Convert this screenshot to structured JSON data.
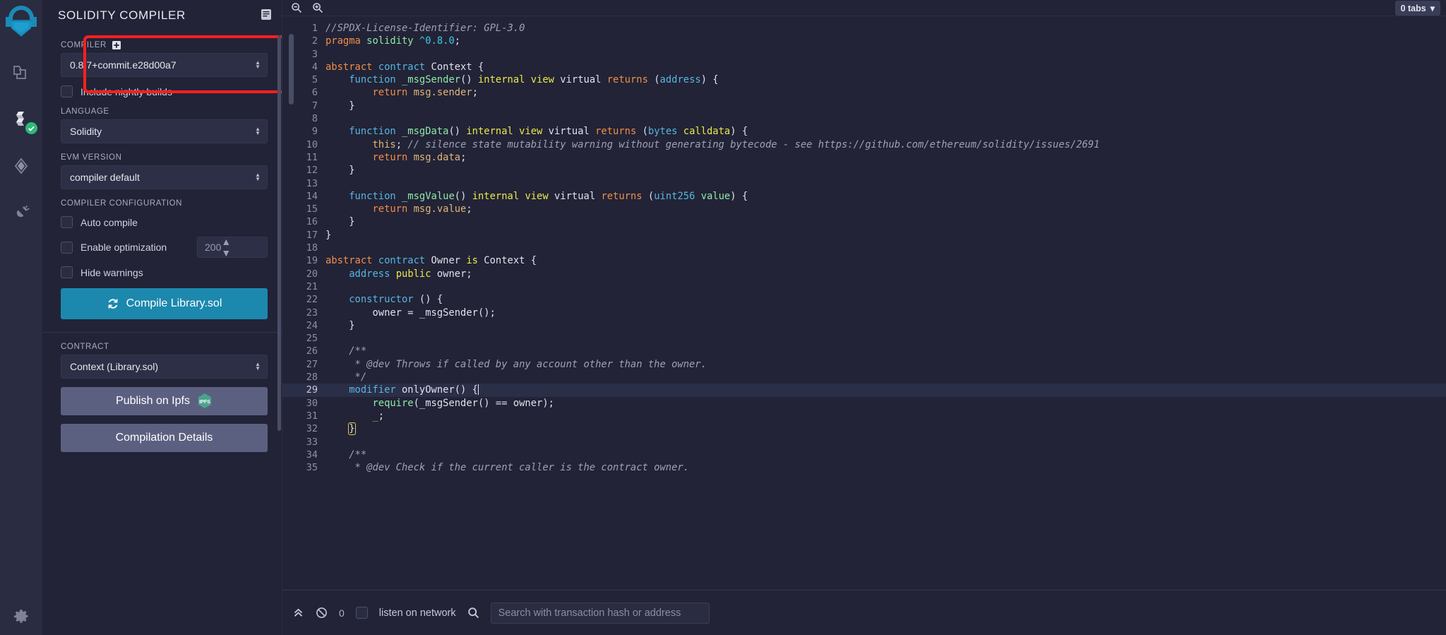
{
  "rail": {
    "logo_icon": "remix-logo-icon",
    "items": [
      {
        "name": "file-explorer-icon",
        "title": "File explorers"
      },
      {
        "name": "solidity-compiler-icon",
        "title": "Solidity compiler",
        "badge": "check"
      },
      {
        "name": "deploy-run-icon",
        "title": "Deploy & run transactions"
      },
      {
        "name": "plugin-manager-icon",
        "title": "Plugin manager"
      }
    ],
    "settings": {
      "name": "settings-gear-icon",
      "title": "Settings"
    }
  },
  "panel": {
    "title": "SOLIDITY COMPILER",
    "header_icon": "article-icon",
    "compiler_label": "COMPILER",
    "compiler_help_icon": "plus-square-icon",
    "compiler_value": "0.8.7+commit.e28d00a7",
    "nightly_label": "Include nightly builds",
    "nightly_checked": false,
    "language_label": "LANGUAGE",
    "language_value": "Solidity",
    "evm_label": "EVM VERSION",
    "evm_value": "compiler default",
    "config_label": "COMPILER CONFIGURATION",
    "auto_compile_label": "Auto compile",
    "auto_compile_checked": false,
    "optimization_label": "Enable optimization",
    "optimization_checked": false,
    "runs_value": "200",
    "hide_warnings_label": "Hide warnings",
    "hide_warnings_checked": false,
    "compile_button": "Compile Library.sol",
    "compile_icon": "refresh-icon",
    "contract_label": "CONTRACT",
    "contract_value": "Context (Library.sol)",
    "publish_button": "Publish on Ipfs",
    "publish_icon": "ipfs-icon",
    "details_button": "Compilation Details"
  },
  "editor": {
    "zoom_out_icon": "zoom-out-icon",
    "zoom_in_icon": "zoom-in-icon",
    "tabs_badge": "0 tabs",
    "tabs_caret_icon": "caret-down-icon",
    "current_line": 29,
    "lines": [
      {
        "n": 1,
        "fold": false,
        "tokens": [
          [
            "cm",
            "//SPDX-License-Identifier: GPL-3.0"
          ]
        ]
      },
      {
        "n": 2,
        "fold": false,
        "tokens": [
          [
            "kw",
            "pragma"
          ],
          [
            "pl",
            " "
          ],
          [
            "id",
            "solidity"
          ],
          [
            "pl",
            " "
          ],
          [
            "num",
            "^0.8.0"
          ],
          [
            "pl",
            ";"
          ]
        ]
      },
      {
        "n": 3,
        "fold": false,
        "tokens": []
      },
      {
        "n": 4,
        "fold": true,
        "tokens": [
          [
            "kw",
            "abstract"
          ],
          [
            "pl",
            " "
          ],
          [
            "ty",
            "contract"
          ],
          [
            "pl",
            " Context {"
          ]
        ]
      },
      {
        "n": 5,
        "fold": true,
        "tokens": [
          [
            "pl",
            "    "
          ],
          [
            "ty",
            "function"
          ],
          [
            "pl",
            " "
          ],
          [
            "id",
            "_msgSender"
          ],
          [
            "pl",
            "() "
          ],
          [
            "mod",
            "internal view"
          ],
          [
            "pl",
            " virtual "
          ],
          [
            "kw",
            "returns"
          ],
          [
            "pl",
            " ("
          ],
          [
            "ty",
            "address"
          ],
          [
            "pl",
            ") {"
          ]
        ]
      },
      {
        "n": 6,
        "fold": false,
        "tokens": [
          [
            "pl",
            "        "
          ],
          [
            "kw",
            "return"
          ],
          [
            "pl",
            " "
          ],
          [
            "str",
            "msg.sender"
          ],
          [
            "pl",
            ";"
          ]
        ]
      },
      {
        "n": 7,
        "fold": false,
        "tokens": [
          [
            "pl",
            "    }"
          ]
        ]
      },
      {
        "n": 8,
        "fold": false,
        "tokens": []
      },
      {
        "n": 9,
        "fold": true,
        "tokens": [
          [
            "pl",
            "    "
          ],
          [
            "ty",
            "function"
          ],
          [
            "pl",
            " "
          ],
          [
            "id",
            "_msgData"
          ],
          [
            "pl",
            "() "
          ],
          [
            "mod",
            "internal view"
          ],
          [
            "pl",
            " virtual "
          ],
          [
            "kw",
            "returns"
          ],
          [
            "pl",
            " ("
          ],
          [
            "ty",
            "bytes"
          ],
          [
            "pl",
            " "
          ],
          [
            "mod",
            "calldata"
          ],
          [
            "pl",
            ") {"
          ]
        ]
      },
      {
        "n": 10,
        "fold": false,
        "tokens": [
          [
            "pl",
            "        "
          ],
          [
            "str",
            "this"
          ],
          [
            "pl",
            "; "
          ],
          [
            "cm",
            "// silence state mutability warning without generating bytecode - see https://github.com/ethereum/solidity/issues/2691"
          ]
        ]
      },
      {
        "n": 11,
        "fold": false,
        "tokens": [
          [
            "pl",
            "        "
          ],
          [
            "kw",
            "return"
          ],
          [
            "pl",
            " "
          ],
          [
            "str",
            "msg.data"
          ],
          [
            "pl",
            ";"
          ]
        ]
      },
      {
        "n": 12,
        "fold": false,
        "tokens": [
          [
            "pl",
            "    }"
          ]
        ]
      },
      {
        "n": 13,
        "fold": false,
        "tokens": []
      },
      {
        "n": 14,
        "fold": true,
        "tokens": [
          [
            "pl",
            "    "
          ],
          [
            "ty",
            "function"
          ],
          [
            "pl",
            " "
          ],
          [
            "id",
            "_msgValue"
          ],
          [
            "pl",
            "() "
          ],
          [
            "mod",
            "internal view"
          ],
          [
            "pl",
            " virtual "
          ],
          [
            "kw",
            "returns"
          ],
          [
            "pl",
            " ("
          ],
          [
            "ty",
            "uint256"
          ],
          [
            "pl",
            " "
          ],
          [
            "id",
            "value"
          ],
          [
            "pl",
            ") {"
          ]
        ]
      },
      {
        "n": 15,
        "fold": false,
        "tokens": [
          [
            "pl",
            "        "
          ],
          [
            "kw",
            "return"
          ],
          [
            "pl",
            " "
          ],
          [
            "str",
            "msg.value"
          ],
          [
            "pl",
            ";"
          ]
        ]
      },
      {
        "n": 16,
        "fold": false,
        "tokens": [
          [
            "pl",
            "    }"
          ]
        ]
      },
      {
        "n": 17,
        "fold": false,
        "tokens": [
          [
            "pl",
            "}"
          ]
        ]
      },
      {
        "n": 18,
        "fold": false,
        "tokens": []
      },
      {
        "n": 19,
        "fold": true,
        "tokens": [
          [
            "kw",
            "abstract"
          ],
          [
            "pl",
            " "
          ],
          [
            "ty",
            "contract"
          ],
          [
            "pl",
            " Owner "
          ],
          [
            "mod",
            "is"
          ],
          [
            "pl",
            " Context {"
          ]
        ]
      },
      {
        "n": 20,
        "fold": false,
        "tokens": [
          [
            "pl",
            "    "
          ],
          [
            "ty",
            "address"
          ],
          [
            "pl",
            " "
          ],
          [
            "mod",
            "public"
          ],
          [
            "pl",
            " owner;"
          ]
        ]
      },
      {
        "n": 21,
        "fold": false,
        "tokens": []
      },
      {
        "n": 22,
        "fold": true,
        "tokens": [
          [
            "pl",
            "    "
          ],
          [
            "ty",
            "constructor"
          ],
          [
            "pl",
            " () {"
          ]
        ]
      },
      {
        "n": 23,
        "fold": false,
        "tokens": [
          [
            "pl",
            "        owner = _msgSender();"
          ]
        ]
      },
      {
        "n": 24,
        "fold": false,
        "tokens": [
          [
            "pl",
            "    }"
          ]
        ]
      },
      {
        "n": 25,
        "fold": false,
        "tokens": []
      },
      {
        "n": 26,
        "fold": true,
        "tokens": [
          [
            "cm",
            "    /**"
          ]
        ]
      },
      {
        "n": 27,
        "fold": false,
        "tokens": [
          [
            "cm",
            "     * @dev Throws if called by any account other than the owner."
          ]
        ]
      },
      {
        "n": 28,
        "fold": false,
        "tokens": [
          [
            "cm",
            "     */"
          ]
        ]
      },
      {
        "n": 29,
        "fold": true,
        "tokens": [
          [
            "pl",
            "    "
          ],
          [
            "ty",
            "modifier"
          ],
          [
            "pl",
            " onlyOwner() {"
          ]
        ]
      },
      {
        "n": 30,
        "fold": false,
        "tokens": [
          [
            "pl",
            "        "
          ],
          [
            "id",
            "require"
          ],
          [
            "pl",
            "(_msgSender() == owner);"
          ]
        ]
      },
      {
        "n": 31,
        "fold": false,
        "tokens": [
          [
            "pl",
            "        "
          ],
          [
            "kw",
            "_"
          ],
          [
            "pl",
            ";"
          ]
        ]
      },
      {
        "n": 32,
        "fold": false,
        "tokens": [
          [
            "pl",
            "    "
          ],
          [
            "brk",
            "}"
          ]
        ]
      },
      {
        "n": 33,
        "fold": false,
        "tokens": []
      },
      {
        "n": 34,
        "fold": true,
        "tokens": [
          [
            "cm",
            "    /**"
          ]
        ]
      },
      {
        "n": 35,
        "fold": false,
        "tokens": [
          [
            "cm",
            "     * @dev Check if the current caller is the contract owner."
          ]
        ]
      }
    ]
  },
  "terminal": {
    "collapse_icon": "chevrons-up-icon",
    "clear_icon": "ban-icon",
    "count": "0",
    "listen_label": "listen on network",
    "listen_checked": false,
    "search_icon": "search-icon",
    "search_value": "",
    "search_placeholder": "Search with transaction hash or address"
  },
  "colors": {
    "accent": "#1c88ae",
    "panel_bg": "#222336",
    "rail_bg": "#2a2c41",
    "highlight_red": "#ff1f1f",
    "success_green": "#2eb87a"
  }
}
